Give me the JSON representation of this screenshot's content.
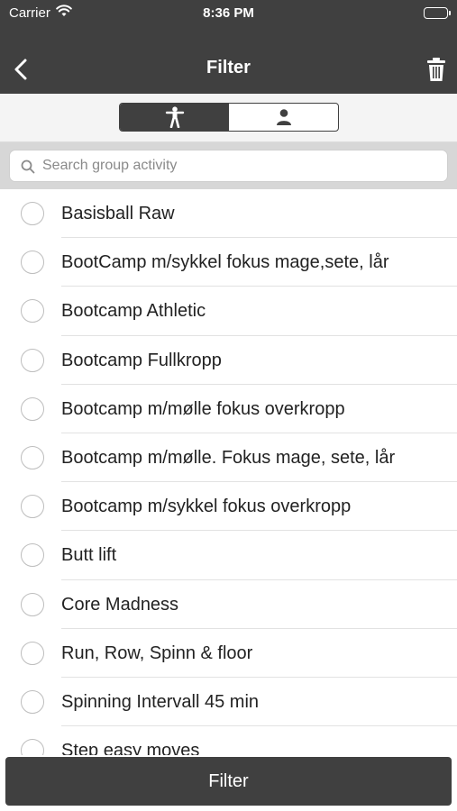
{
  "status_bar": {
    "carrier": "Carrier",
    "time": "8:36 PM",
    "wifi_icon": "wifi-icon",
    "battery_icon": "battery-icon"
  },
  "nav": {
    "title": "Filter",
    "back_icon": "chevron-left-icon",
    "trash_icon": "trash-icon"
  },
  "segments": [
    {
      "icon": "person-activity-icon",
      "selected": true
    },
    {
      "icon": "person-icon",
      "selected": false
    }
  ],
  "search": {
    "placeholder": "Search group activity",
    "value": "",
    "icon": "search-icon"
  },
  "activities": [
    {
      "label": "Basisball Raw",
      "selected": false
    },
    {
      "label": "BootCamp m/sykkel fokus mage,sete, lår",
      "selected": false
    },
    {
      "label": "Bootcamp Athletic",
      "selected": false
    },
    {
      "label": "Bootcamp Fullkropp",
      "selected": false
    },
    {
      "label": "Bootcamp m/mølle fokus overkropp",
      "selected": false
    },
    {
      "label": "Bootcamp m/mølle. Fokus mage, sete, lår",
      "selected": false
    },
    {
      "label": "Bootcamp m/sykkel fokus overkropp",
      "selected": false
    },
    {
      "label": "Butt lift",
      "selected": false
    },
    {
      "label": "Core Madness",
      "selected": false
    },
    {
      "label": "Run, Row, Spinn & floor",
      "selected": false
    },
    {
      "label": "Spinning Intervall 45 min",
      "selected": false
    },
    {
      "label": "Step easy moves",
      "selected": false
    }
  ],
  "footer": {
    "button_label": "Filter"
  },
  "colors": {
    "bar_dark": "#404040",
    "search_bg": "#d7d7d7",
    "radio_border": "#bdbdbd"
  }
}
